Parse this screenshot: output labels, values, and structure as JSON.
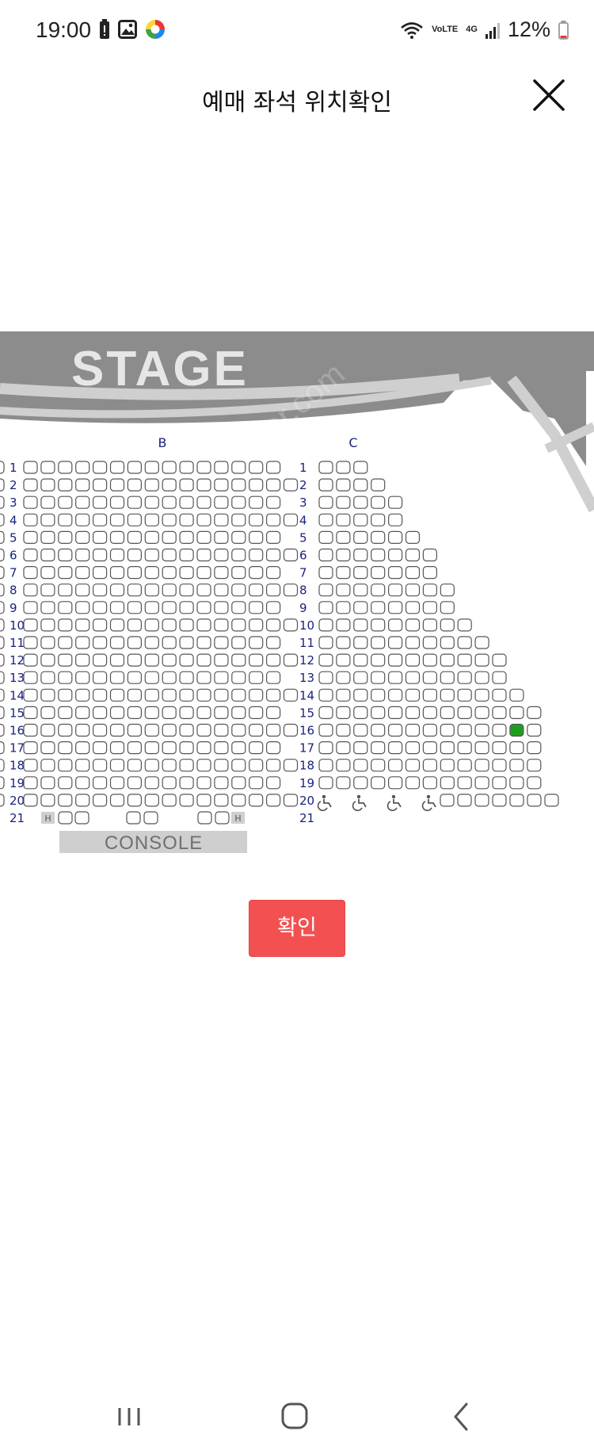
{
  "status_bar": {
    "time": "19:00",
    "battery_percent": "12%",
    "network_labels": [
      "VoLTE",
      "4G"
    ],
    "icons": [
      "battery-alert-icon",
      "gallery-icon",
      "app-logo-icon",
      "wifi-icon",
      "signal-icon",
      "battery-icon"
    ]
  },
  "header": {
    "title": "예매 좌석 위치확인",
    "close_icon": "close-icon"
  },
  "seatmap": {
    "stage_label": "STAGE",
    "console_label": "CONSOLE",
    "watermark": "naver.com",
    "section_labels": [
      "B",
      "C"
    ],
    "row_labels": [
      "1",
      "2",
      "3",
      "4",
      "5",
      "6",
      "7",
      "8",
      "9",
      "10",
      "11",
      "12",
      "13",
      "14",
      "15",
      "16",
      "17",
      "18",
      "19",
      "20",
      "21"
    ],
    "hold_label": "H",
    "section_c_seats_per_row": [
      3,
      4,
      5,
      5,
      6,
      7,
      7,
      8,
      8,
      9,
      10,
      11,
      11,
      12,
      13,
      13,
      13,
      13,
      13,
      8
    ],
    "wheelchair_seats_row20": 4,
    "highlighted_seat": {
      "section": "C",
      "row": "16",
      "seat_index": 11
    },
    "colors": {
      "seat_outline": "#555555",
      "selected_seat": "#1e9e1e",
      "stage_fill": "#8c8c8c",
      "aisle_fill": "#cfcfcf",
      "label_color": "#1a237e"
    }
  },
  "actions": {
    "confirm_label": "확인",
    "confirm_color": "#f35151"
  },
  "nav_bar": {
    "icons": [
      "recents-icon",
      "home-icon",
      "back-icon"
    ]
  }
}
